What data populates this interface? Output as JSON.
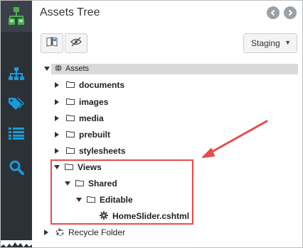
{
  "panel": {
    "title": "Assets Tree",
    "back_icon": "chevron-left-icon",
    "forward_icon": "chevron-right-icon"
  },
  "sidebar": {
    "logo": "site-structure-logo-icon",
    "items": [
      {
        "icon": "sitemap-icon"
      },
      {
        "icon": "tags-icon"
      },
      {
        "icon": "list-icon"
      },
      {
        "icon": "search-icon"
      }
    ]
  },
  "toolbar": {
    "book_button_icon": "book-icon",
    "hidden_button_icon": "eye-slash-icon",
    "environment_selected": "Staging"
  },
  "tree": {
    "root": {
      "label": "Assets"
    },
    "items": [
      {
        "label": "documents"
      },
      {
        "label": "images"
      },
      {
        "label": "media"
      },
      {
        "label": "prebuilt"
      },
      {
        "label": "stylesheets"
      },
      {
        "label": "Views"
      },
      {
        "label": "Shared"
      },
      {
        "label": "Editable"
      },
      {
        "label": "HomeSlider.cshtml"
      }
    ],
    "recycle": {
      "label": "Recycle Folder"
    }
  },
  "colors": {
    "sidebar": "#2b3137",
    "sidebar_icon": "#1a9bd7",
    "logo_green": "#4caf50",
    "annotation": "#e74c4c",
    "selection": "#d9d9d9"
  }
}
